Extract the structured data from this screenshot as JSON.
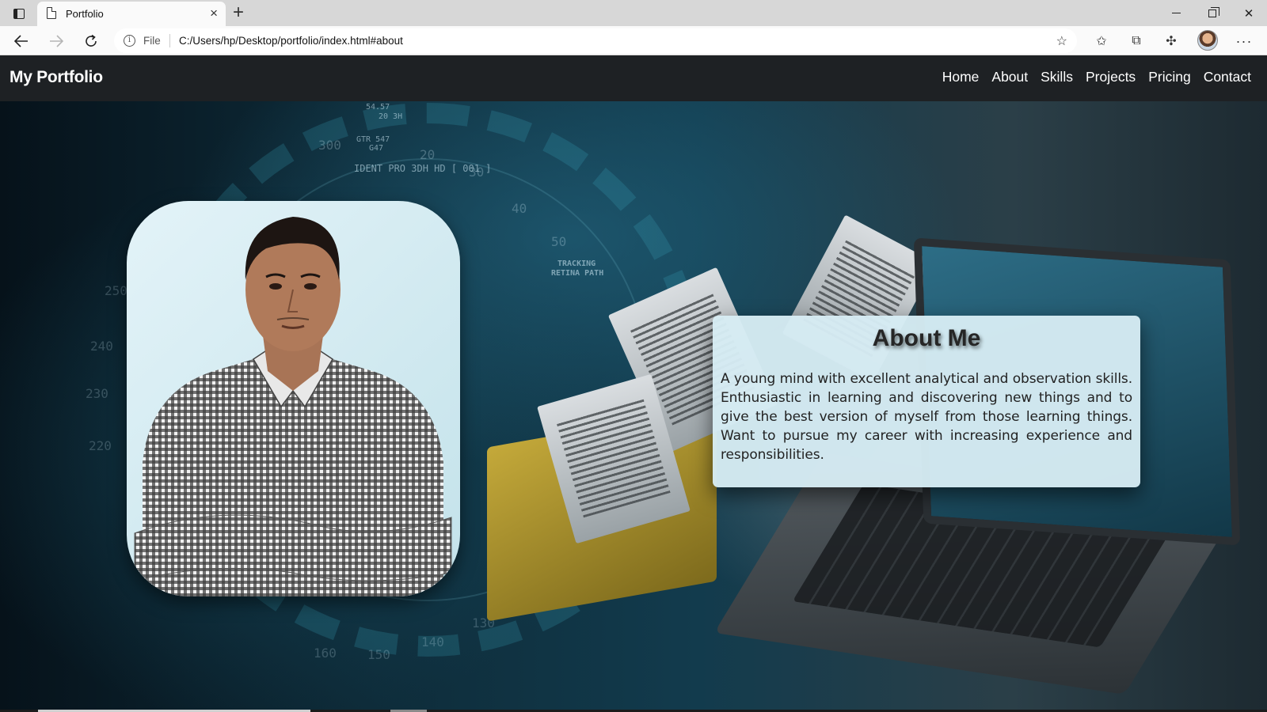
{
  "browser": {
    "tab_title": "Portfolio",
    "tab_close": "×",
    "new_tab": "+",
    "address_scheme": "File",
    "address_url": "C:/Users/hp/Desktop/portfolio/index.html#about",
    "more": "···"
  },
  "navbar": {
    "brand": "My Portfolio",
    "links": [
      "Home",
      "About",
      "Skills",
      "Projects",
      "Pricing",
      "Contact"
    ]
  },
  "background_text": {
    "ident": "IDENT PRO 3DH HD [ 001 ]",
    "tracking": "TRACKING",
    "retina": "RETINA PATH",
    "code_a": "54.57",
    "code_b": "20   3H",
    "code_c": "GTR   547",
    "code_d": "G47",
    "gauge_300": "300",
    "gauge_20": "20",
    "gauge_30": "30",
    "gauge_40": "40",
    "gauge_50": "50",
    "gauge_250": "250",
    "gauge_240": "240",
    "gauge_230": "230",
    "gauge_220": "220",
    "gauge_160": "160",
    "gauge_150": "150",
    "gauge_140": "140",
    "gauge_130": "130"
  },
  "about": {
    "title": "About Me",
    "text": "A young mind with excellent analytical and observation skills. Enthusiastic in learning and discovering new things and to give the best version of myself from those learning things. Want to pursue my career with increasing experience and responsibilities."
  },
  "colors": {
    "navbar_bg": "#1e2124",
    "card_bg": "#d6ecf4",
    "page_accent": "#123b4d"
  },
  "icons": {
    "tab_switcher": "tab-switcher-icon",
    "page": "page-icon",
    "back": "back-arrow-icon",
    "forward": "forward-arrow-icon",
    "reload": "reload-icon",
    "info": "info-icon",
    "add_favorite": "star-plus-icon",
    "favorites": "favorites-icon",
    "collections": "collections-icon",
    "extensions": "extensions-icon",
    "profile": "profile-avatar",
    "menu": "more-icon"
  }
}
